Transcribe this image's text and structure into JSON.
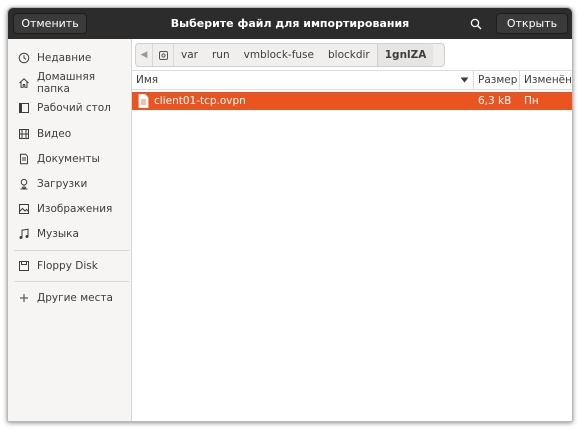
{
  "header": {
    "title": "Выберите файл для импортирования",
    "cancel_label": "Отменить",
    "open_label": "Открыть"
  },
  "sidebar": {
    "items": [
      {
        "label": "Недавние",
        "icon": "clock-icon"
      },
      {
        "label": "Домашняя папка",
        "icon": "home-icon"
      },
      {
        "label": "Рабочий стол",
        "icon": "desktop-icon"
      },
      {
        "label": "Видео",
        "icon": "film-icon"
      },
      {
        "label": "Документы",
        "icon": "document-icon"
      },
      {
        "label": "Загрузки",
        "icon": "download-icon"
      },
      {
        "label": "Изображения",
        "icon": "image-icon"
      },
      {
        "label": "Музыка",
        "icon": "music-icon"
      },
      {
        "label": "Floppy Disk",
        "icon": "floppy-icon"
      },
      {
        "label": "Другие места",
        "icon": "plus-icon"
      }
    ]
  },
  "pathbar": {
    "segments": [
      "var",
      "run",
      "vmblock-fuse",
      "blockdir",
      "1gnlZA"
    ]
  },
  "columns": {
    "name": "Имя",
    "size": "Размер",
    "modified": "Изменён"
  },
  "files": [
    {
      "name": "client01-tcp.ovpn",
      "size": "6,3 kB",
      "modified": "Пн",
      "selected": true
    }
  ],
  "colors": {
    "accent": "#e95420",
    "headerbar": "#2c2c2c",
    "sidebar": "#f6f5f4"
  }
}
